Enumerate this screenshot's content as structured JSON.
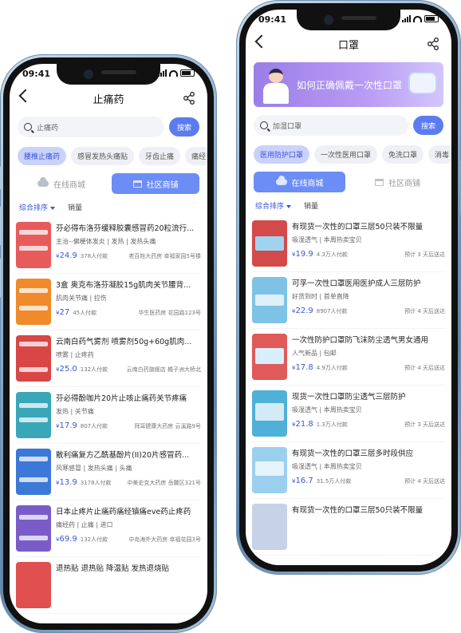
{
  "left_phone": {
    "status_time": "09:41",
    "title": "止痛药",
    "search": {
      "value": "止痛药",
      "button": "搜索"
    },
    "chips": [
      "腰椎止痛药",
      "感冒发热头痛贴",
      "牙齿止痛",
      "痛经"
    ],
    "store_tabs": [
      "在线商城",
      "社区商铺"
    ],
    "sort": [
      "综合排序",
      "销量"
    ],
    "products": [
      {
        "name": "芬必得布洛芬缓释胶囊感冒药20粒流行...",
        "tags": "主治--偏梗体发炎 | 发热 | 发热头痛",
        "price": "24.9",
        "sold": "378人付款",
        "pharmacy": "老百姓大药房 幸福家园5号楼",
        "thumb_color": "#e85b5b"
      },
      {
        "name": "3盒 奥克布洛芬凝胶15g肌肉关节腰背...",
        "tags": "肌肉关节痛 | 拉伤",
        "price": "27",
        "sold": "45人付款",
        "pharmacy": "华生医药房 花园路123号",
        "thumb_color": "#f08a2a"
      },
      {
        "name": "云南白药气雾剂 喷雾剂50g+60g肌肉...",
        "tags": "喷雾 | 止疼药",
        "price": "25.0",
        "sold": "132人付款",
        "pharmacy": "云南白药旗舰店 橘子洲大桥北",
        "thumb_color": "#d94646"
      },
      {
        "name": "芬必得酚咖片20片止咳止痛药关节疼痛",
        "tags": "发热 | 关节痛",
        "price": "17.9",
        "sold": "807人付款",
        "pharmacy": "拜耳健康大药房 云溪路9号",
        "thumb_color": "#3aa7b9"
      },
      {
        "name": "散利痛复方乙酰基酚片(II)20片感冒药...",
        "tags": "风寒感冒 | 发热头痛 | 头痛",
        "price": "13.9",
        "sold": "3178人付款",
        "pharmacy": "中美史克大药房 岳麓区321号",
        "thumb_color": "#3c78d8"
      },
      {
        "name": "日本止疼片止痛药痛经镇痛eve药止疼药",
        "tags": "痛经药 | 止痛 | 进口",
        "price": "69.9",
        "sold": "132人付款",
        "pharmacy": "中岛海外大药房 幸福花园3号",
        "thumb_color": "#7a5cc9"
      },
      {
        "name": "退热贴 退热贴 降温贴 发热退烧贴",
        "tags": "",
        "price": "",
        "sold": "",
        "pharmacy": "",
        "thumb_color": "#e05050"
      }
    ]
  },
  "right_phone": {
    "status_time": "09:41",
    "title": "口罩",
    "banner_text": "如何正确佩戴一次性口罩",
    "search": {
      "placeholder": "加湿口罩",
      "button": "搜索"
    },
    "chips": [
      "医用防护口罩",
      "一次性医用口罩",
      "免洗口罩",
      "消毒"
    ],
    "store_tabs": [
      "在线商城",
      "社区商铺"
    ],
    "sort": [
      "综合排序",
      "销量"
    ],
    "products": [
      {
        "name": "有现货一次性的口罩三层50只装不限量",
        "tags": "吸湿透气 | 本周热卖宝贝",
        "price": "19.9",
        "sold": "4.3万人付款",
        "eta": "预计 3 天后送达",
        "thumb_color": "#d44a4a"
      },
      {
        "name": "可孚一次性口罩医用医护成人三层防护",
        "tags": "好货到时 | 首单直降",
        "price": "22.9",
        "sold": "8907人付款",
        "eta": "预计 4 天后送达",
        "thumb_color": "#7ec3e6"
      },
      {
        "name": "一次性防护口罩防飞沫防尘透气男女通用",
        "tags": "人气新品 | 包邮",
        "price": "17.8",
        "sold": "4.9万人付款",
        "eta": "预计 4 天后送达",
        "thumb_color": "#e05a5a"
      },
      {
        "name": "现货一次性口罩防尘透气三层防护",
        "tags": "吸湿透气 | 本周热卖宝贝",
        "price": "21.8",
        "sold": "1.3万人付款",
        "eta": "预计 3 天后送达",
        "thumb_color": "#4fb0d8"
      },
      {
        "name": "有现货一次性的口罩三层多时段供应",
        "tags": "吸湿透气 | 本周热卖宝贝",
        "price": "16.7",
        "sold": "31.5万人付款",
        "eta": "预计 4 天后送达",
        "thumb_color": "#9ad0ee"
      },
      {
        "name": "有现货一次性的口罩三层50只装不限量",
        "tags": "",
        "price": "",
        "sold": "",
        "eta": "",
        "thumb_color": "#c6d3e6"
      }
    ]
  },
  "currency": "¥",
  "colors": {
    "accent": "#5b7cf0",
    "price": "#3b57d8",
    "chip_active_bg": "#c9d2fb"
  }
}
